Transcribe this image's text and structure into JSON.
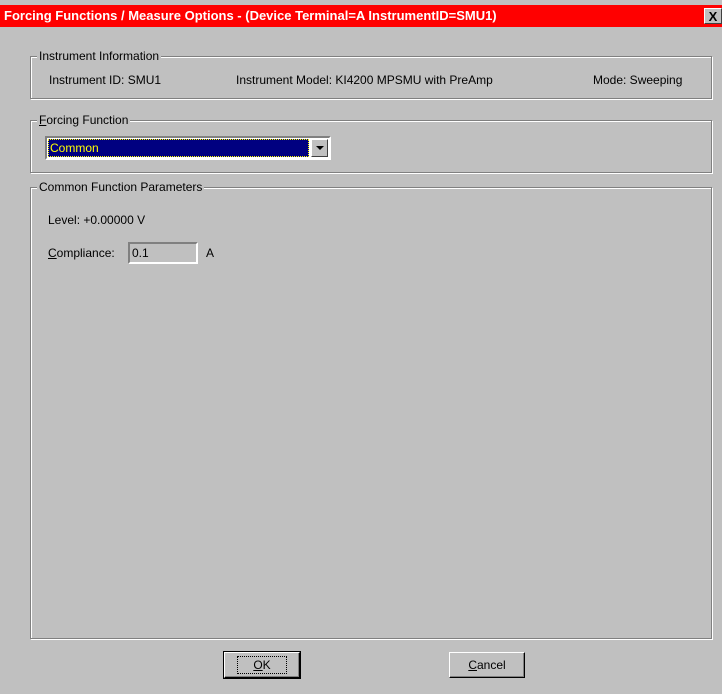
{
  "window": {
    "title": "Forcing Functions / Measure Options - (Device Terminal=A  InstrumentID=SMU1)",
    "close_label": "X"
  },
  "instrument_info": {
    "group_title": "Instrument Information",
    "id_text": "Instrument ID:  SMU1",
    "model_text": "Instrument Model:  KI4200 MPSMU with PreAmp",
    "mode_text": "Mode:  Sweeping"
  },
  "forcing_function": {
    "title_mnemonic": "F",
    "title_rest": "orcing Function",
    "selected_value": "Common"
  },
  "parameters": {
    "group_title": "Common Function Parameters",
    "level_text": "Level:   +0.00000 V",
    "compliance_mnemonic": "C",
    "compliance_rest": "ompliance:",
    "compliance_value": "0.1",
    "compliance_unit": "A"
  },
  "buttons": {
    "ok_mnemonic": "O",
    "ok_rest": "K",
    "cancel_mnemonic": "C",
    "cancel_rest": "ancel"
  },
  "colors": {
    "titlebar_bg": "#ff0000",
    "dialog_bg": "#c0c0c0",
    "selection_bg": "#000080",
    "selection_text": "#ffff00"
  }
}
